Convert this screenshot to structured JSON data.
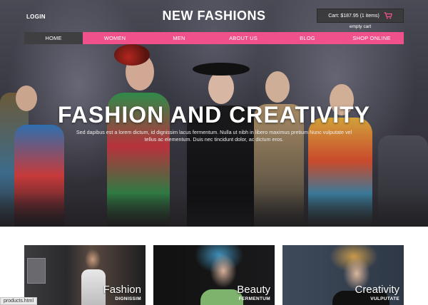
{
  "header": {
    "login_label": "LOGIN",
    "site_title": "NEW FASHIONS",
    "cart_text": "Cart: $187.95 (1 items)",
    "empty_cart_label": "empty cart"
  },
  "nav": {
    "items": [
      {
        "label": "HOME"
      },
      {
        "label": "WOMEN"
      },
      {
        "label": "MEN"
      },
      {
        "label": "ABOUT US"
      },
      {
        "label": "BLOG"
      },
      {
        "label": "SHOP ONLINE"
      }
    ],
    "active_index": 0
  },
  "hero": {
    "title": "FASHION AND CREATIVITY",
    "subtitle": "Sed dapibus est a lorem dictum, id dignissim lacus fermentum. Nulla ut nibh in libero maximus pretium Nunc vulputate vel tellus ac elementum. Duis nec tincidunt dolor, ac dictum eros."
  },
  "cards": [
    {
      "title": "Fashion",
      "subtitle": "DIGNISSIM"
    },
    {
      "title": "Beauty",
      "subtitle": "FERMENTUM"
    },
    {
      "title": "Creativity",
      "subtitle": "VULPUTATE"
    }
  ],
  "status_bar": {
    "url": "products.html"
  },
  "colors": {
    "accent_pink": "#f1518b",
    "nav_active": "#3f3f41",
    "cart_bg": "#3b3b3d"
  }
}
